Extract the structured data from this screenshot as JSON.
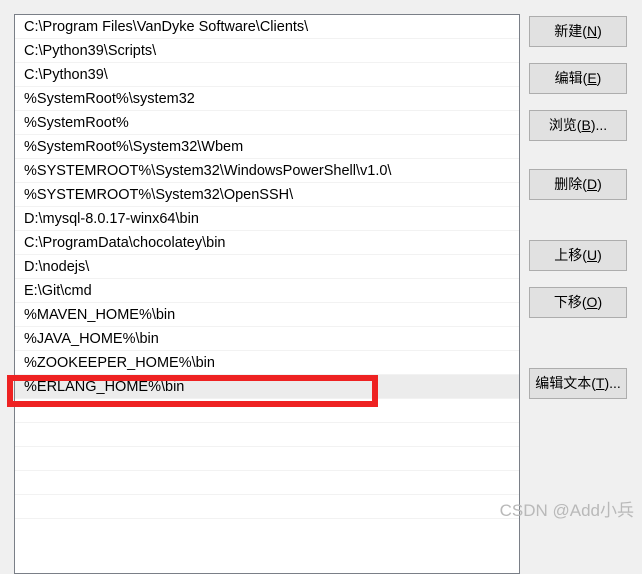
{
  "dialog": {
    "name": "environment-variable-path-editor"
  },
  "path_list": {
    "entries": [
      "C:\\Program Files\\VanDyke Software\\Clients\\",
      "C:\\Python39\\Scripts\\",
      "C:\\Python39\\",
      "%SystemRoot%\\system32",
      "%SystemRoot%",
      "%SystemRoot%\\System32\\Wbem",
      "%SYSTEMROOT%\\System32\\WindowsPowerShell\\v1.0\\",
      "%SYSTEMROOT%\\System32\\OpenSSH\\",
      "D:\\mysql-8.0.17-winx64\\bin",
      "C:\\ProgramData\\chocolatey\\bin",
      "D:\\nodejs\\",
      "E:\\Git\\cmd",
      "%MAVEN_HOME%\\bin",
      "%JAVA_HOME%\\bin",
      "%ZOOKEEPER_HOME%\\bin",
      "%ERLANG_HOME%\\bin"
    ],
    "selected_index": 15,
    "empty_row_count": 5
  },
  "buttons": {
    "new": {
      "text": "新建(N)",
      "pre": "新建(",
      "mnemonic": "N",
      "post": ")"
    },
    "edit": {
      "text": "编辑(E)",
      "pre": "编辑(",
      "mnemonic": "E",
      "post": ")"
    },
    "browse": {
      "text": "浏览(B)...",
      "pre": "浏览(",
      "mnemonic": "B",
      "post": ")..."
    },
    "delete": {
      "text": "删除(D)",
      "pre": "删除(",
      "mnemonic": "D",
      "post": ")"
    },
    "move_up": {
      "text": "上移(U)",
      "pre": "上移(",
      "mnemonic": "U",
      "post": ")"
    },
    "move_down": {
      "text": "下移(O)",
      "pre": "下移(",
      "mnemonic": "O",
      "post": ")"
    },
    "edit_text": {
      "text": "编辑文本(T)...",
      "pre": "编辑文本(",
      "mnemonic": "T",
      "post": ")..."
    }
  },
  "annotation": {
    "highlight_color": "#ee2222",
    "highlight_target": "%ERLANG_HOME%\\bin"
  },
  "watermark": {
    "text": "CSDN @Add小兵"
  },
  "colors": {
    "window_background": "#f0f0f0",
    "listbox_background": "#ffffff",
    "listbox_border": "#7a7f87",
    "row_separator": "#f2f2f2",
    "selected_row_background": "#ececec",
    "button_face": "#e1e1e1",
    "button_border": "#adadad",
    "text": "#000000",
    "watermark_text": "#b9b9b9"
  }
}
